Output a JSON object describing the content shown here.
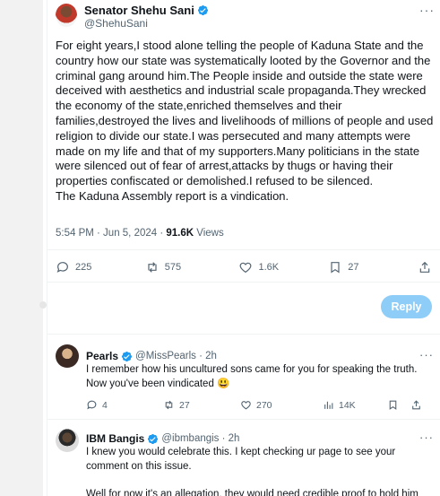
{
  "tweet": {
    "author_name": "Senator Shehu Sani",
    "author_handle": "@ShehuSani",
    "text": "For eight years,I stood alone telling the people of Kaduna State and the country how our state was systematically looted by the Governor and the criminal gang around him.The People inside and outside the state were deceived with aesthetics and industrial scale propaganda.They wrecked the economy of the state,enriched themselves and their families,destroyed the lives and livelihoods of millions of people and used religion to divide our state.I was persecuted and many attempts were made on my life and that of my supporters.Many politicians in the state were silenced out of fear of arrest,attacks by thugs or having their properties confiscated or demolished.I refused to be silenced.\nThe Kaduna Assembly report is a vindication.",
    "time": "5:54 PM · Jun 5, 2024 · ",
    "views_count": "91.6K",
    "views_label": " Views",
    "stats": {
      "replies": "225",
      "reposts": "575",
      "likes": "1.6K",
      "bookmarks": "27"
    }
  },
  "reply_button_label": "Reply",
  "colors": {
    "accent": "#1d9bf0",
    "reply_button": "#8ecdf8",
    "muted": "#536471",
    "text": "#0f1419"
  },
  "replies": [
    {
      "name": "Pearls",
      "handle": "@MissPearls · 2h",
      "text": "I remember how his uncultured sons came for you for speaking the truth.\nNow you've been vindicated 😃",
      "stats": {
        "replies": "4",
        "reposts": "27",
        "likes": "270",
        "views": "14K"
      }
    },
    {
      "name": "IBM Bangis",
      "handle": "@ibmbangis · 2h",
      "text": "I knew you would celebrate this. I kept checking ur page to see your\ncomment on this issue.\n\nWell for now it's an allegation, they would need credible proof to hold him"
    }
  ]
}
